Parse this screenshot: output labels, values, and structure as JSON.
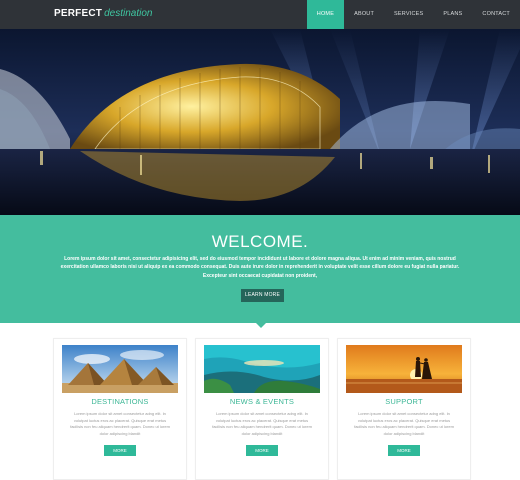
{
  "header": {
    "logo_main": "PERFECT",
    "logo_sub": "destination",
    "nav": [
      "HOME",
      "ABOUT",
      "SERVICES",
      "PLANS",
      "CONTACT"
    ],
    "active_index": 0
  },
  "welcome": {
    "title": "WELCOME.",
    "text": "Lorem ipsum dolor sit amet, consectetur adipisicing elit, sed do eiusmod tempor incididunt ut labore et dolore magna aliqua. Ut enim ad minim veniam, quis nostrud exercitation ullamco laboris nisi ut aliquip ex ea commodo consequat. Duis aute irure dolor in reprehenderit in voluptate velit esse cillum dolore eu fugiat nulla pariatur. Excepteur sint occaecat cupidatat non proident,",
    "button": "LEARN MORE"
  },
  "cards": [
    {
      "title": "DESTINATIONS",
      "text": "Lorem ipsum dolor sit amet consectetur adng elit. In volutpat luctus eros ac placerat. Quisque erat metus facilisis non feu aliquam hendrerit quam. Donec ut lorem dolor adipiscing blandit",
      "button": "MORE",
      "picture": "pyramids-photo"
    },
    {
      "title": "NEWS & EVENTS",
      "text": "Lorem ipsum dolor sit amet consectetur adng elit. In volutpat luctus eros ac placerat. Quisque erat metus facilisis non feu aliquam hendrerit quam. Donec ut lorem dolor adipiscing blandit",
      "button": "MORE",
      "picture": "tropical-beach-photo"
    },
    {
      "title": "SUPPORT",
      "text": "Lorem ipsum dolor sit amet consectetur adng elit. In volutpat luctus eros ac placerat. Quisque erat metus facilisis non feu aliquam hendrerit quam. Donec ut lorem dolor adipiscing blandit",
      "button": "MORE",
      "picture": "sunset-couple-photo"
    }
  ],
  "colors": {
    "accent": "#2fb999",
    "welcome_bg": "#44bd9e",
    "nav_bg": "#2f3338",
    "button_dark": "#25655a"
  }
}
